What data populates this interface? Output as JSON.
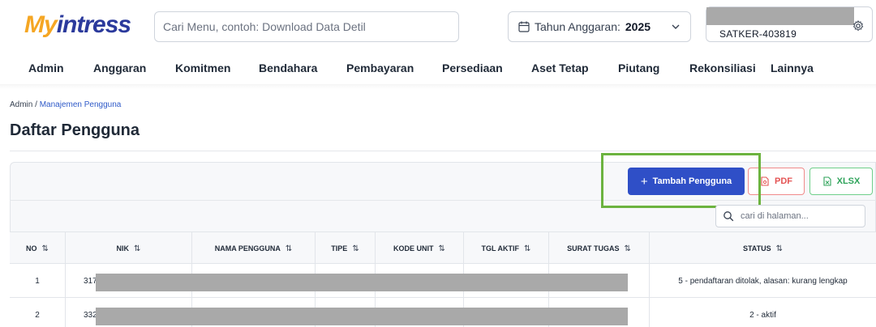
{
  "brand": {
    "logo_my": "My",
    "logo_rest": "intress"
  },
  "header": {
    "search_placeholder": "Cari Menu, contoh: Download Data Detil",
    "year_label": "Tahun Anggaran:",
    "year_value": "2025",
    "satker": "SATKER-403819"
  },
  "nav": {
    "items": [
      "Admin",
      "Anggaran",
      "Komitmen",
      "Bendahara",
      "Pembayaran",
      "Persediaan",
      "Aset Tetap",
      "Piutang",
      "Rekonsiliasi",
      "Lainnya"
    ]
  },
  "breadcrumb": {
    "root": "Admin",
    "separator": " / ",
    "current": "Manajemen Pengguna"
  },
  "page": {
    "title": "Daftar Pengguna"
  },
  "toolbar": {
    "add_label": "Tambah Pengguna",
    "pdf_label": "PDF",
    "xlsx_label": "XLSX",
    "table_search_placeholder": "cari di halaman..."
  },
  "table": {
    "sort_glyph": "⇅",
    "columns": [
      "NO",
      "NIK",
      "NAMA PENGGUNA",
      "TIPE",
      "KODE UNIT",
      "TGL AKTIF",
      "SURAT TUGAS",
      "STATUS"
    ],
    "rows": [
      {
        "no": "1",
        "nik": "317",
        "status": "5 - pendaftaran ditolak, alasan: kurang lengkap"
      },
      {
        "no": "2",
        "nik": "332",
        "status": "2 - aktif"
      }
    ]
  },
  "colors": {
    "primary": "#2f4fc7",
    "highlight": "#6cb33f",
    "pdf": "#e45454",
    "xlsx": "#2ea35a"
  }
}
